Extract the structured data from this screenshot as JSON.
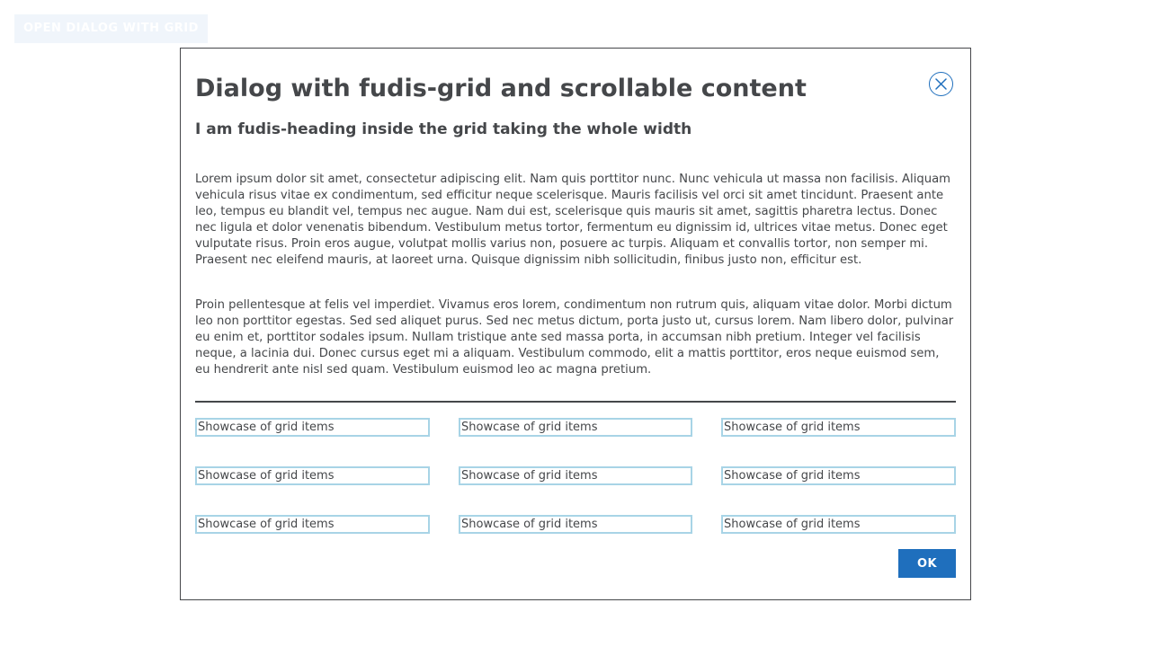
{
  "page": {
    "open_button_label": "OPEN DIALOG WITH GRID"
  },
  "dialog": {
    "title": "Dialog with fudis-grid and scrollable content",
    "close_icon": "close-icon",
    "heading": "I am fudis-heading inside the grid taking the whole width",
    "paragraphs": [
      "Lorem ipsum dolor sit amet, consectetur adipiscing elit. Nam quis porttitor nunc. Nunc vehicula ut massa non facilisis. Aliquam vehicula risus vitae ex condimentum, sed efficitur neque scelerisque. Mauris facilisis vel orci sit amet tincidunt. Praesent ante leo, tempus eu blandit vel, tempus nec augue. Nam dui est, scelerisque quis mauris sit amet, sagittis pharetra lectus. Donec nec ligula et dolor venenatis bibendum. Vestibulum metus tortor, fermentum eu dignissim id, ultrices vitae metus. Donec eget vulputate risus. Proin eros augue, volutpat mollis varius non, posuere ac turpis. Aliquam et convallis tortor, non semper mi. Praesent nec eleifend mauris, at laoreet urna. Quisque dignissim nibh sollicitudin, finibus justo non, efficitur est.",
      "Proin pellentesque at felis vel imperdiet. Vivamus eros lorem, condimentum non rutrum quis, aliquam vitae dolor. Morbi dictum leo non porttitor egestas. Sed sed aliquet purus. Sed nec metus dictum, porta justo ut, cursus lorem. Nam libero dolor, pulvinar eu enim et, porttitor sodales ipsum. Nullam tristique ante sed massa porta, in accumsan nibh pretium. Integer vel facilisis neque, a lacinia dui. Donec cursus eget mi a aliquam. Vestibulum commodo, elit a mattis porttitor, eros neque euismod sem, eu hendrerit ante nisl sed quam. Vestibulum euismod leo ac magna pretium."
    ],
    "grid_items": [
      "Showcase of grid items",
      "Showcase of grid items",
      "Showcase of grid items",
      "Showcase of grid items",
      "Showcase of grid items",
      "Showcase of grid items",
      "Showcase of grid items",
      "Showcase of grid items",
      "Showcase of grid items"
    ],
    "ok_label": "OK"
  },
  "colors": {
    "primary": "#1f6fbd",
    "text": "#45474a",
    "grid_item_border": "#a8d4e6",
    "open_button_bg": "#f0f5fb"
  }
}
